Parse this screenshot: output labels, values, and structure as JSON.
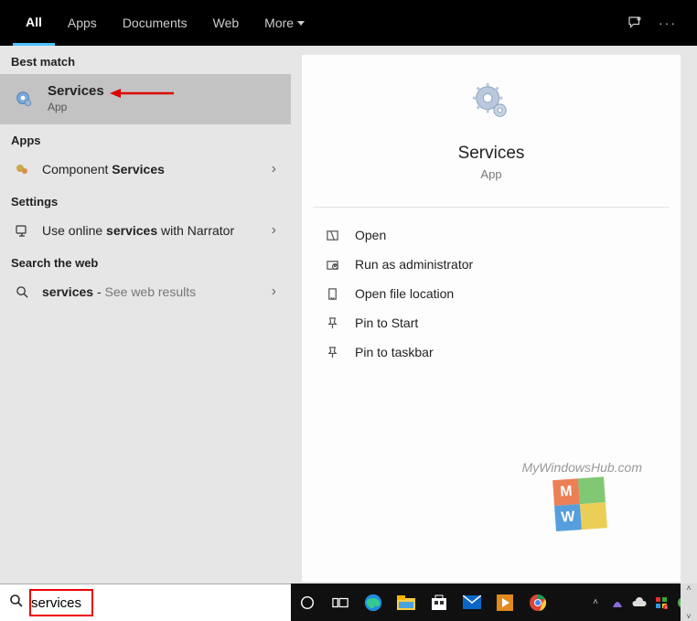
{
  "tabs": {
    "items": [
      "All",
      "Apps",
      "Documents",
      "Web",
      "More"
    ],
    "active_index": 0
  },
  "left": {
    "best_match_header": "Best match",
    "best_match": {
      "title": "Services",
      "subtitle": "App"
    },
    "apps_header": "Apps",
    "apps_item_prefix": "Component ",
    "apps_item_bold": "Services",
    "settings_header": "Settings",
    "settings_item_prefix": "Use online ",
    "settings_item_bold": "services",
    "settings_item_suffix": " with Narrator",
    "web_header": "Search the web",
    "web_item_bold": "services",
    "web_item_suffix": " - ",
    "web_item_hint": "See web results"
  },
  "detail": {
    "title": "Services",
    "subtitle": "App",
    "actions": {
      "open": "Open",
      "run_admin": "Run as administrator",
      "open_loc": "Open file location",
      "pin_start": "Pin to Start",
      "pin_taskbar": "Pin to taskbar"
    }
  },
  "search": {
    "value": "services"
  },
  "watermark": "MyWindowsHub.com"
}
